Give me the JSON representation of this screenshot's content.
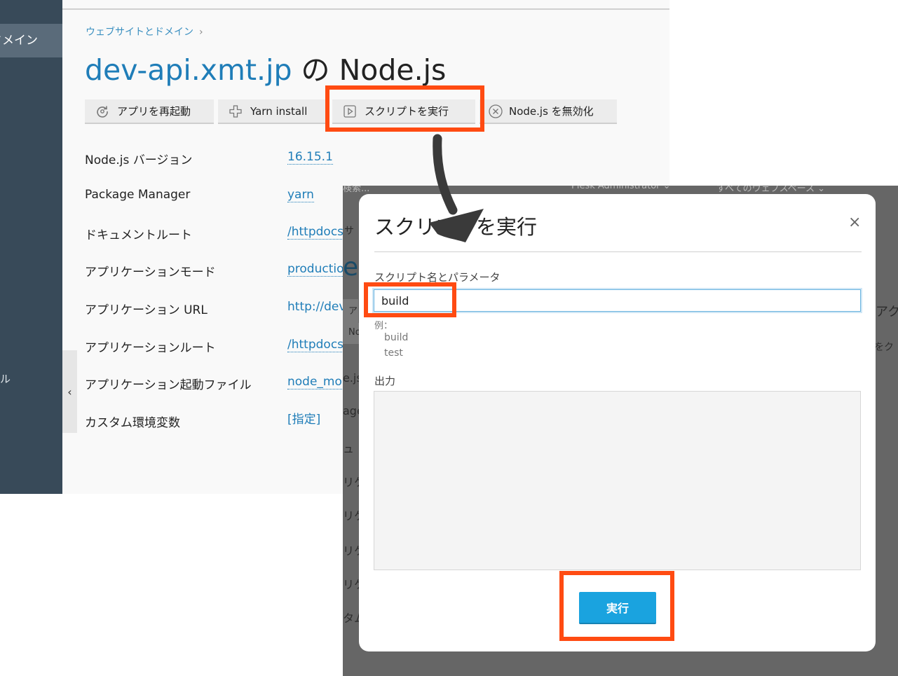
{
  "sidebar": {
    "active_item": "ドメイン",
    "fragment": "ル"
  },
  "breadcrumb": {
    "link": "ウェブサイトとドメイン",
    "separator": "›"
  },
  "page_title": {
    "domain": "dev-api.xmt.jp",
    "rest": " の Node.js"
  },
  "toolbar": {
    "restart": "アプリを再起動",
    "yarn_install": "Yarn install",
    "run_script": "スクリプトを実行",
    "disable_node": "Node.js を無効化"
  },
  "properties": [
    {
      "label": "Node.js バージョン",
      "value": "16.15.1"
    },
    {
      "label": "Package Manager",
      "value": "yarn"
    },
    {
      "label": "ドキュメントルート",
      "value": "/httpdocs"
    },
    {
      "label": "アプリケーションモード",
      "value": "productio"
    },
    {
      "label": "アプリケーション URL",
      "value": "http://dev"
    },
    {
      "label": "アプリケーションルート",
      "value": "/httpdocs"
    },
    {
      "label": "アプリケーション起動ファイル",
      "value": "node_mo"
    },
    {
      "label": "カスタム環境変数",
      "value": "[指定]"
    }
  ],
  "background_page": {
    "header": {
      "search": "検索...",
      "user": "Plesk Administrator ⌄",
      "workspace": "すべてのウェブスペース ⌄"
    },
    "fragments": [
      "サ",
      "ev",
      "ア",
      "アク",
      "No",
      "をク",
      "e.js",
      "age",
      "ュ",
      "リケ",
      "リケ",
      "リケ",
      "リケ",
      "タム"
    ]
  },
  "modal": {
    "title": "スクリプトを実行",
    "close": "×",
    "field_label": "スクリプト名とパラメータ",
    "input_value": "build",
    "examples_label": "例：",
    "examples": [
      "build",
      "test"
    ],
    "output_label": "出力",
    "run_button": "実行"
  },
  "colors": {
    "accent": "#1f7db8",
    "highlight": "#ff4b12",
    "run_button": "#1aa3df",
    "sidebar": "#384a59"
  }
}
